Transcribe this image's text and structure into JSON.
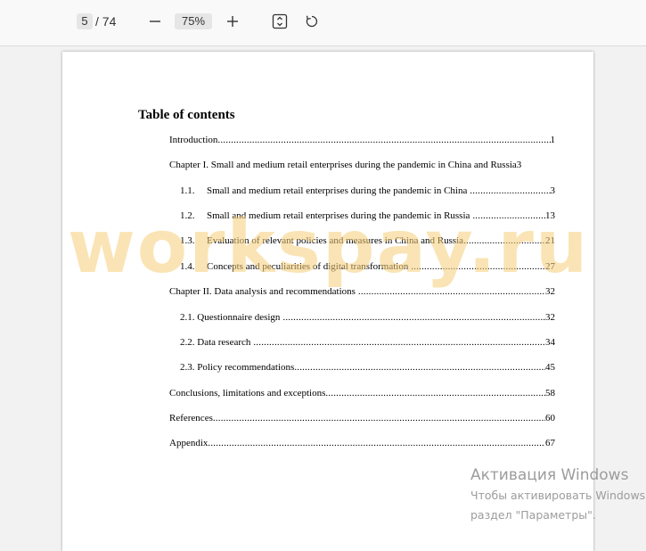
{
  "toolbar": {
    "current_page": "5",
    "total_pages": "/ 74",
    "zoom": "75%",
    "icons": [
      "minus-icon",
      "plus-icon",
      "fit-page-icon",
      "rotate-icon"
    ]
  },
  "document": {
    "toc_title": "Table of contents",
    "entries": [
      {
        "num": "",
        "title": "Introduction",
        "page": "1"
      },
      {
        "num": "",
        "title": "Chapter I. Small and medium retail enterprises during the pandemic in China and Russia",
        "page": "3"
      },
      {
        "num": "1.1.",
        "title": "Small and medium retail enterprises during the pandemic in China",
        "page": "3"
      },
      {
        "num": "1.2.",
        "title": "Small and medium retail enterprises during the pandemic in Russia",
        "page": "13"
      },
      {
        "num": "1.3.",
        "title": "Evaluation of relevant policies and measures in China and Russia",
        "page": "21"
      },
      {
        "num": "1.4.",
        "title": "Concepts and peculiarities of digital transformation",
        "page": "27"
      },
      {
        "num": "",
        "title": "Chapter II. Data analysis and recommendations",
        "page": "32"
      },
      {
        "num": "",
        "title": "2.1. Questionnaire design",
        "page": "32"
      },
      {
        "num": "",
        "title": "2.2. Data research",
        "page": "34"
      },
      {
        "num": "",
        "title": "2.3. Policy recommendations",
        "page": "45"
      },
      {
        "num": "",
        "title": "Conclusions, limitations and exceptions",
        "page": "58"
      },
      {
        "num": "",
        "title": "References",
        "page": "60"
      },
      {
        "num": "",
        "title": "Appendix",
        "page": "67"
      }
    ]
  },
  "watermark": "workspay.ru",
  "windows_activation": {
    "title": "Активация Windows",
    "line1": "Чтобы активировать Windows, перейдите в",
    "line2": "раздел \"Параметры\"."
  },
  "colors": {
    "watermark": "#f6cd78",
    "activation_text": "#9c9c9c"
  }
}
